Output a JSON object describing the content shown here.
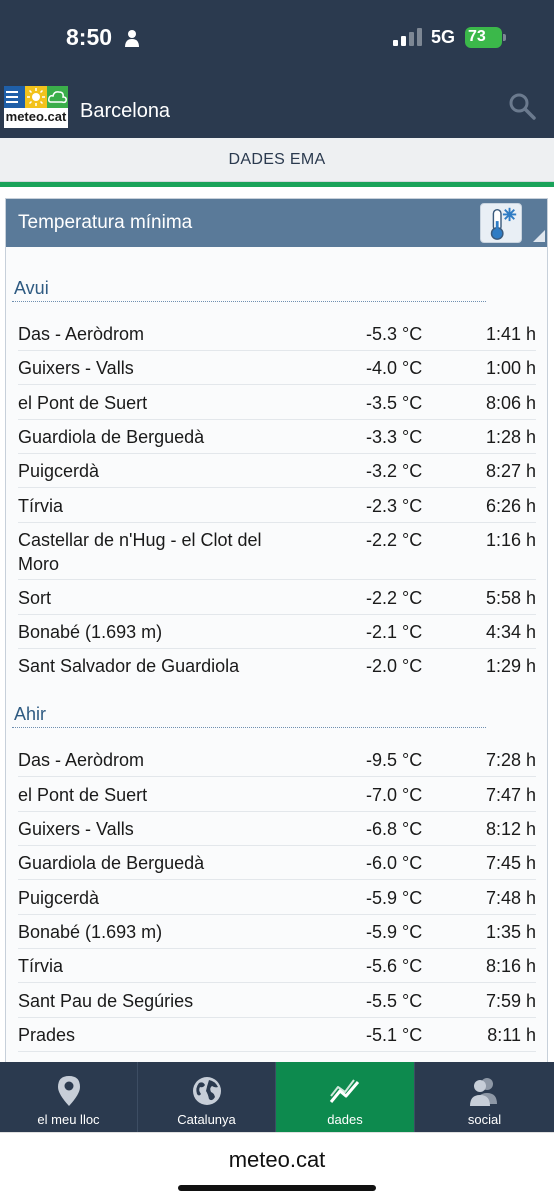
{
  "status": {
    "time": "8:50",
    "network": "5G",
    "battery": "73"
  },
  "header": {
    "logo_text": "meteo.cat",
    "title": "Barcelona"
  },
  "section_tab": "DADES EMA",
  "card": {
    "title": "Temperatura mínima",
    "groups": [
      {
        "label": "Avui",
        "rows": [
          {
            "station": "Das - Aeròdrom",
            "temp": "-5.3 °C",
            "hour": "1:41 h"
          },
          {
            "station": "Guixers - Valls",
            "temp": "-4.0 °C",
            "hour": "1:00 h"
          },
          {
            "station": "el Pont de Suert",
            "temp": "-3.5 °C",
            "hour": "8:06 h"
          },
          {
            "station": "Guardiola de Berguedà",
            "temp": "-3.3 °C",
            "hour": "1:28 h"
          },
          {
            "station": "Puigcerdà",
            "temp": "-3.2 °C",
            "hour": "8:27 h"
          },
          {
            "station": "Tírvia",
            "temp": "-2.3 °C",
            "hour": "6:26 h"
          },
          {
            "station": "Castellar de n'Hug - el Clot del Moro",
            "temp": "-2.2 °C",
            "hour": "1:16 h"
          },
          {
            "station": "Sort",
            "temp": "-2.2 °C",
            "hour": "5:58 h"
          },
          {
            "station": "Bonabé (1.693 m)",
            "temp": "-2.1 °C",
            "hour": "4:34 h"
          },
          {
            "station": "Sant Salvador de Guardiola",
            "temp": "-2.0 °C",
            "hour": "1:29 h"
          }
        ]
      },
      {
        "label": "Ahir",
        "rows": [
          {
            "station": "Das - Aeròdrom",
            "temp": "-9.5 °C",
            "hour": "7:28 h"
          },
          {
            "station": "el Pont de Suert",
            "temp": "-7.0 °C",
            "hour": "7:47 h"
          },
          {
            "station": "Guixers - Valls",
            "temp": "-6.8 °C",
            "hour": "8:12 h"
          },
          {
            "station": "Guardiola de Berguedà",
            "temp": "-6.0 °C",
            "hour": "7:45 h"
          },
          {
            "station": "Puigcerdà",
            "temp": "-5.9 °C",
            "hour": "7:48 h"
          },
          {
            "station": "Bonabé (1.693 m)",
            "temp": "-5.9 °C",
            "hour": "1:35 h"
          },
          {
            "station": "Tírvia",
            "temp": "-5.6 °C",
            "hour": "8:16 h"
          },
          {
            "station": "Sant Pau de Segúries",
            "temp": "-5.5 °C",
            "hour": "7:59 h"
          },
          {
            "station": "Prades",
            "temp": "-5.1 °C",
            "hour": "8:11 h"
          }
        ]
      }
    ]
  },
  "nav": [
    {
      "label": "el meu lloc",
      "icon": "location-pin-icon"
    },
    {
      "label": "Catalunya",
      "icon": "globe-icon"
    },
    {
      "label": "dades",
      "icon": "chart-line-icon",
      "active": true
    },
    {
      "label": "social",
      "icon": "people-icon"
    }
  ],
  "browser": {
    "url": "meteo.cat"
  },
  "colors": {
    "header_bg": "#2b3a4f",
    "accent_green": "#1aa35a",
    "card_header": "#5a7a99",
    "active_nav": "#0d8a4e"
  }
}
